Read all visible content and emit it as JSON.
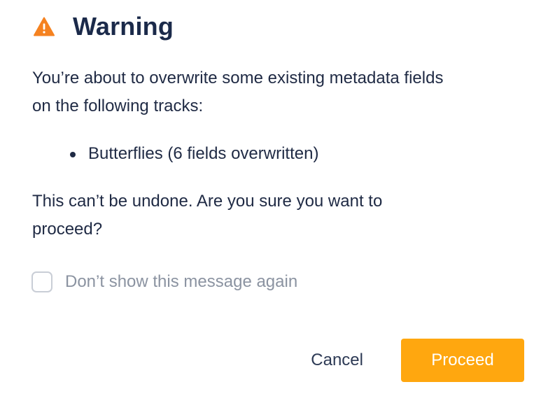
{
  "dialog": {
    "title": "Warning",
    "icon": "warning-triangle-icon",
    "accent_color": "#ffa70f",
    "intro_line1": "You’re about to overwrite some existing metadata fields",
    "intro_line2": "on the following tracks:",
    "tracks": [
      {
        "label": "Butterflies (6 fields overwritten)"
      }
    ],
    "confirm_line1": "This can’t be undone. Are you sure you want to",
    "confirm_line2": "proceed?",
    "checkbox": {
      "label": "Don’t show this message again",
      "checked": false
    },
    "buttons": {
      "cancel_label": "Cancel",
      "proceed_label": "Proceed"
    }
  }
}
